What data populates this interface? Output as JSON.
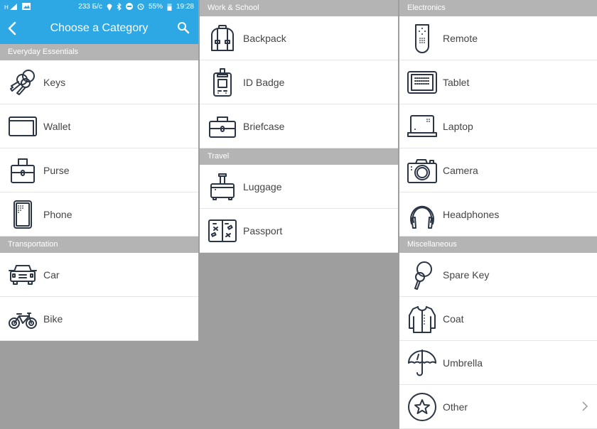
{
  "status_bar": {
    "network_speed": "233 Б/с",
    "battery": "55%",
    "time": "19:28",
    "icons": [
      "signal-icon",
      "image-icon",
      "location-icon",
      "bluetooth-icon",
      "dnd-icon",
      "alarm-icon",
      "battery-icon"
    ]
  },
  "app_bar": {
    "title": "Choose a Category",
    "back_icon": "back-chevron-icon",
    "search_icon": "search-icon"
  },
  "colors": {
    "accent": "#2ea8e4",
    "section_header": "#b4b4b4",
    "background": "#9e9e9e",
    "icon_stroke": "#2b3544",
    "text": "#444444"
  },
  "sections": [
    {
      "title": "Everyday Essentials",
      "items": [
        {
          "label": "Keys",
          "icon": "keys-icon"
        },
        {
          "label": "Wallet",
          "icon": "wallet-icon"
        },
        {
          "label": "Purse",
          "icon": "purse-icon"
        },
        {
          "label": "Phone",
          "icon": "phone-icon"
        }
      ]
    },
    {
      "title": "Transportation",
      "items": [
        {
          "label": "Car",
          "icon": "car-icon"
        },
        {
          "label": "Bike",
          "icon": "bike-icon"
        }
      ]
    },
    {
      "title": "Work & School",
      "items": [
        {
          "label": "Backpack",
          "icon": "backpack-icon"
        },
        {
          "label": "ID Badge",
          "icon": "id-badge-icon"
        },
        {
          "label": "Briefcase",
          "icon": "briefcase-icon"
        }
      ]
    },
    {
      "title": "Travel",
      "items": [
        {
          "label": "Luggage",
          "icon": "luggage-icon"
        },
        {
          "label": "Passport",
          "icon": "passport-icon"
        }
      ]
    },
    {
      "title": "Electronics",
      "items": [
        {
          "label": "Remote",
          "icon": "remote-icon"
        },
        {
          "label": "Tablet",
          "icon": "tablet-icon"
        },
        {
          "label": "Laptop",
          "icon": "laptop-icon"
        },
        {
          "label": "Camera",
          "icon": "camera-icon"
        },
        {
          "label": "Headphones",
          "icon": "headphones-icon"
        }
      ]
    },
    {
      "title": "Miscellaneous",
      "items": [
        {
          "label": "Spare Key",
          "icon": "spare-key-icon"
        },
        {
          "label": "Coat",
          "icon": "coat-icon"
        },
        {
          "label": "Umbrella",
          "icon": "umbrella-icon"
        },
        {
          "label": "Other",
          "icon": "star-icon",
          "has_chevron": true
        }
      ]
    }
  ]
}
